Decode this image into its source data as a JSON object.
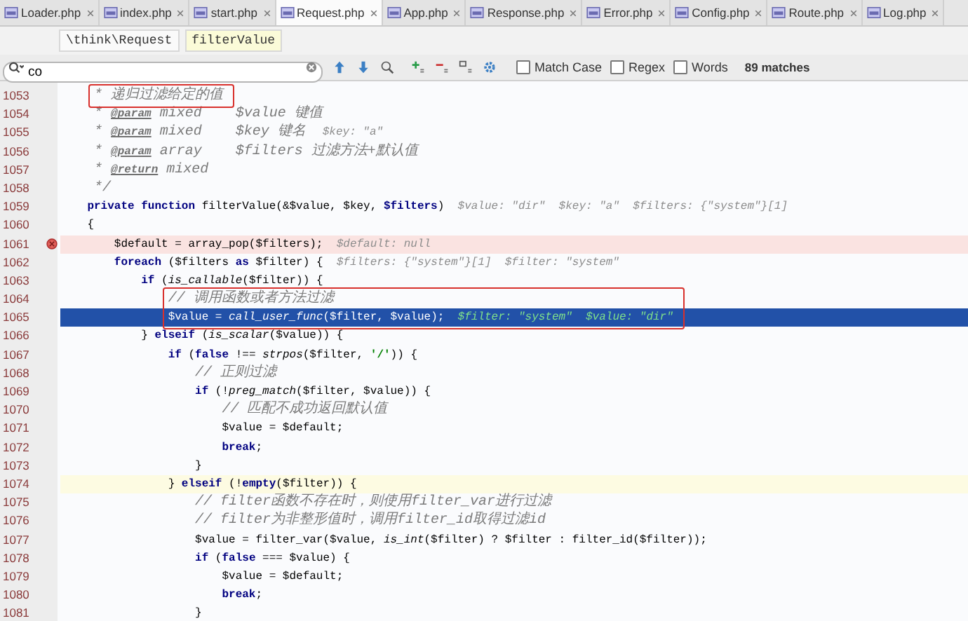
{
  "tabs": [
    {
      "label": "Loader.php",
      "selected": false
    },
    {
      "label": "index.php",
      "selected": false
    },
    {
      "label": "start.php",
      "selected": false
    },
    {
      "label": "Request.php",
      "selected": true
    },
    {
      "label": "App.php",
      "selected": false
    },
    {
      "label": "Response.php",
      "selected": false
    },
    {
      "label": "Error.php",
      "selected": false
    },
    {
      "label": "Config.php",
      "selected": false
    },
    {
      "label": "Route.php",
      "selected": false
    },
    {
      "label": "Log.php",
      "selected": false
    }
  ],
  "breadcrumbs": [
    {
      "label": "\\think\\Request",
      "selected": false
    },
    {
      "label": "filterValue",
      "selected": true
    }
  ],
  "search": {
    "value": "co",
    "options": [
      {
        "label": "Match Case",
        "checked": false
      },
      {
        "label": "Regex",
        "checked": false
      },
      {
        "label": "Words",
        "checked": false
      }
    ],
    "matches": "89 matches"
  },
  "lines": [
    {
      "number": "1053",
      "kind": "normal",
      "boxed": true,
      "segments": [
        {
          "kind": "comment",
          "text": "     * 递归过滤给定的值"
        }
      ]
    },
    {
      "number": "1054",
      "kind": "normal",
      "boxed": false,
      "segments": [
        {
          "kind": "comment",
          "text": "     * "
        },
        {
          "kind": "doc_tag",
          "text": "@param"
        },
        {
          "kind": "comment",
          "text": " mixed    $value 键值"
        }
      ]
    },
    {
      "number": "1055",
      "kind": "normal",
      "boxed": false,
      "segments": [
        {
          "kind": "comment",
          "text": "     * "
        },
        {
          "kind": "doc_tag",
          "text": "@param"
        },
        {
          "kind": "comment",
          "text": " mixed    $key 键名  "
        },
        {
          "kind": "hint",
          "text": "$key: \"a\""
        }
      ]
    },
    {
      "number": "1056",
      "kind": "normal",
      "boxed": false,
      "segments": [
        {
          "kind": "comment",
          "text": "     * "
        },
        {
          "kind": "doc_tag",
          "text": "@param"
        },
        {
          "kind": "comment",
          "text": " array    $filters 过滤方法+默认值"
        }
      ]
    },
    {
      "number": "1057",
      "kind": "normal",
      "boxed": false,
      "segments": [
        {
          "kind": "comment",
          "text": "     * "
        },
        {
          "kind": "doc_tag",
          "text": "@return"
        },
        {
          "kind": "comment",
          "text": " mixed"
        }
      ]
    },
    {
      "number": "1058",
      "kind": "normal",
      "boxed": false,
      "segments": [
        {
          "kind": "comment",
          "text": "     */"
        }
      ]
    },
    {
      "number": "1059",
      "kind": "normal",
      "boxed": false,
      "segments": [
        {
          "kind": "keyword",
          "text": "    private function "
        },
        {
          "kind": "plain",
          "text": "filterValue(&$value, $key, "
        },
        {
          "kind": "keyword",
          "text": "$filters"
        },
        {
          "kind": "plain",
          "text": ")"
        },
        {
          "kind": "hint",
          "text": "  $value: \"dir\"  $key: \"a\"  $filters: {\"system\"}[1]"
        }
      ]
    },
    {
      "number": "1060",
      "kind": "normal",
      "boxed": false,
      "segments": [
        {
          "kind": "plain",
          "text": "    {"
        }
      ]
    },
    {
      "number": "1061",
      "kind": "breakpoint",
      "boxed": false,
      "segments": [
        {
          "kind": "plain",
          "text": "        $default = array_pop($filters);"
        },
        {
          "kind": "hint",
          "text": "  $default: null"
        }
      ]
    },
    {
      "number": "1062",
      "kind": "normal",
      "boxed": false,
      "segments": [
        {
          "kind": "keyword",
          "text": "        foreach"
        },
        {
          "kind": "plain",
          "text": " ($filters "
        },
        {
          "kind": "keyword",
          "text": "as"
        },
        {
          "kind": "plain",
          "text": " $filter) {"
        },
        {
          "kind": "hint",
          "text": "  $filters: {\"system\"}[1]  $filter: \"system\""
        }
      ]
    },
    {
      "number": "1063",
      "kind": "normal",
      "boxed": false,
      "segments": [
        {
          "kind": "keyword",
          "text": "            if"
        },
        {
          "kind": "plain",
          "text": " ("
        },
        {
          "kind": "function",
          "text": "is_callable"
        },
        {
          "kind": "plain",
          "text": "($filter)) {"
        }
      ]
    },
    {
      "number": "1064",
      "kind": "normal",
      "boxed": true,
      "segments": [
        {
          "kind": "comment",
          "text": "                // 调用函数或者方法过滤"
        }
      ]
    },
    {
      "number": "1065",
      "kind": "execution",
      "boxed": true,
      "segments": [
        {
          "kind": "plain",
          "text": "                $value = "
        },
        {
          "kind": "function",
          "text": "call_user_func"
        },
        {
          "kind": "plain",
          "text": "($filter, $value);"
        },
        {
          "kind": "hint",
          "text": "  $filter: \"system\"  $value: \"dir\""
        }
      ]
    },
    {
      "number": "1066",
      "kind": "normal",
      "boxed": false,
      "segments": [
        {
          "kind": "plain",
          "text": "            } "
        },
        {
          "kind": "keyword",
          "text": "elseif"
        },
        {
          "kind": "plain",
          "text": " ("
        },
        {
          "kind": "function",
          "text": "is_scalar"
        },
        {
          "kind": "plain",
          "text": "($value)) {"
        }
      ]
    },
    {
      "number": "1067",
      "kind": "normal",
      "boxed": false,
      "segments": [
        {
          "kind": "keyword",
          "text": "                if"
        },
        {
          "kind": "plain",
          "text": " ("
        },
        {
          "kind": "keyword",
          "text": "false"
        },
        {
          "kind": "plain",
          "text": " !== "
        },
        {
          "kind": "function",
          "text": "strpos"
        },
        {
          "kind": "plain",
          "text": "($filter, "
        },
        {
          "kind": "string",
          "text": "'/'"
        },
        {
          "kind": "plain",
          "text": ")) {"
        }
      ]
    },
    {
      "number": "1068",
      "kind": "normal",
      "boxed": false,
      "segments": [
        {
          "kind": "comment",
          "text": "                    // 正则过滤"
        }
      ]
    },
    {
      "number": "1069",
      "kind": "normal",
      "boxed": false,
      "segments": [
        {
          "kind": "keyword",
          "text": "                    if"
        },
        {
          "kind": "plain",
          "text": " (!"
        },
        {
          "kind": "function",
          "text": "preg_match"
        },
        {
          "kind": "plain",
          "text": "($filter, $value)) {"
        }
      ]
    },
    {
      "number": "1070",
      "kind": "normal",
      "boxed": false,
      "segments": [
        {
          "kind": "comment",
          "text": "                        // 匹配不成功返回默认值"
        }
      ]
    },
    {
      "number": "1071",
      "kind": "normal",
      "boxed": false,
      "segments": [
        {
          "kind": "plain",
          "text": "                        $value = $default;"
        }
      ]
    },
    {
      "number": "1072",
      "kind": "normal",
      "boxed": false,
      "segments": [
        {
          "kind": "keyword",
          "text": "                        break"
        },
        {
          "kind": "plain",
          "text": ";"
        }
      ]
    },
    {
      "number": "1073",
      "kind": "normal",
      "boxed": false,
      "segments": [
        {
          "kind": "plain",
          "text": "                    }"
        }
      ]
    },
    {
      "number": "1074",
      "kind": "caret",
      "boxed": false,
      "segments": [
        {
          "kind": "plain",
          "text": "                } "
        },
        {
          "kind": "keyword",
          "text": "elseif"
        },
        {
          "kind": "plain",
          "text": " (!"
        },
        {
          "kind": "keyword",
          "text": "empty"
        },
        {
          "kind": "plain",
          "text": "($filter)) {"
        }
      ]
    },
    {
      "number": "1075",
      "kind": "normal",
      "boxed": false,
      "segments": [
        {
          "kind": "comment",
          "text": "                    // filter函数不存在时，则使用filter_var进行过滤"
        }
      ]
    },
    {
      "number": "1076",
      "kind": "normal",
      "boxed": false,
      "segments": [
        {
          "kind": "comment",
          "text": "                    // filter为非整形值时，调用filter_id取得过滤id"
        }
      ]
    },
    {
      "number": "1077",
      "kind": "normal",
      "boxed": false,
      "segments": [
        {
          "kind": "plain",
          "text": "                    $value = filter_var($value, "
        },
        {
          "kind": "function",
          "text": "is_int"
        },
        {
          "kind": "plain",
          "text": "($filter) ? $filter : filter_id($filter));"
        }
      ]
    },
    {
      "number": "1078",
      "kind": "normal",
      "boxed": false,
      "segments": [
        {
          "kind": "keyword",
          "text": "                    if"
        },
        {
          "kind": "plain",
          "text": " ("
        },
        {
          "kind": "keyword",
          "text": "false"
        },
        {
          "kind": "plain",
          "text": " === $value) {"
        }
      ]
    },
    {
      "number": "1079",
      "kind": "normal",
      "boxed": false,
      "segments": [
        {
          "kind": "plain",
          "text": "                        $value = $default;"
        }
      ]
    },
    {
      "number": "1080",
      "kind": "normal",
      "boxed": false,
      "segments": [
        {
          "kind": "keyword",
          "text": "                        break"
        },
        {
          "kind": "plain",
          "text": ";"
        }
      ]
    },
    {
      "number": "1081",
      "kind": "normal",
      "boxed": false,
      "segments": [
        {
          "kind": "plain",
          "text": "                    }"
        }
      ]
    }
  ]
}
